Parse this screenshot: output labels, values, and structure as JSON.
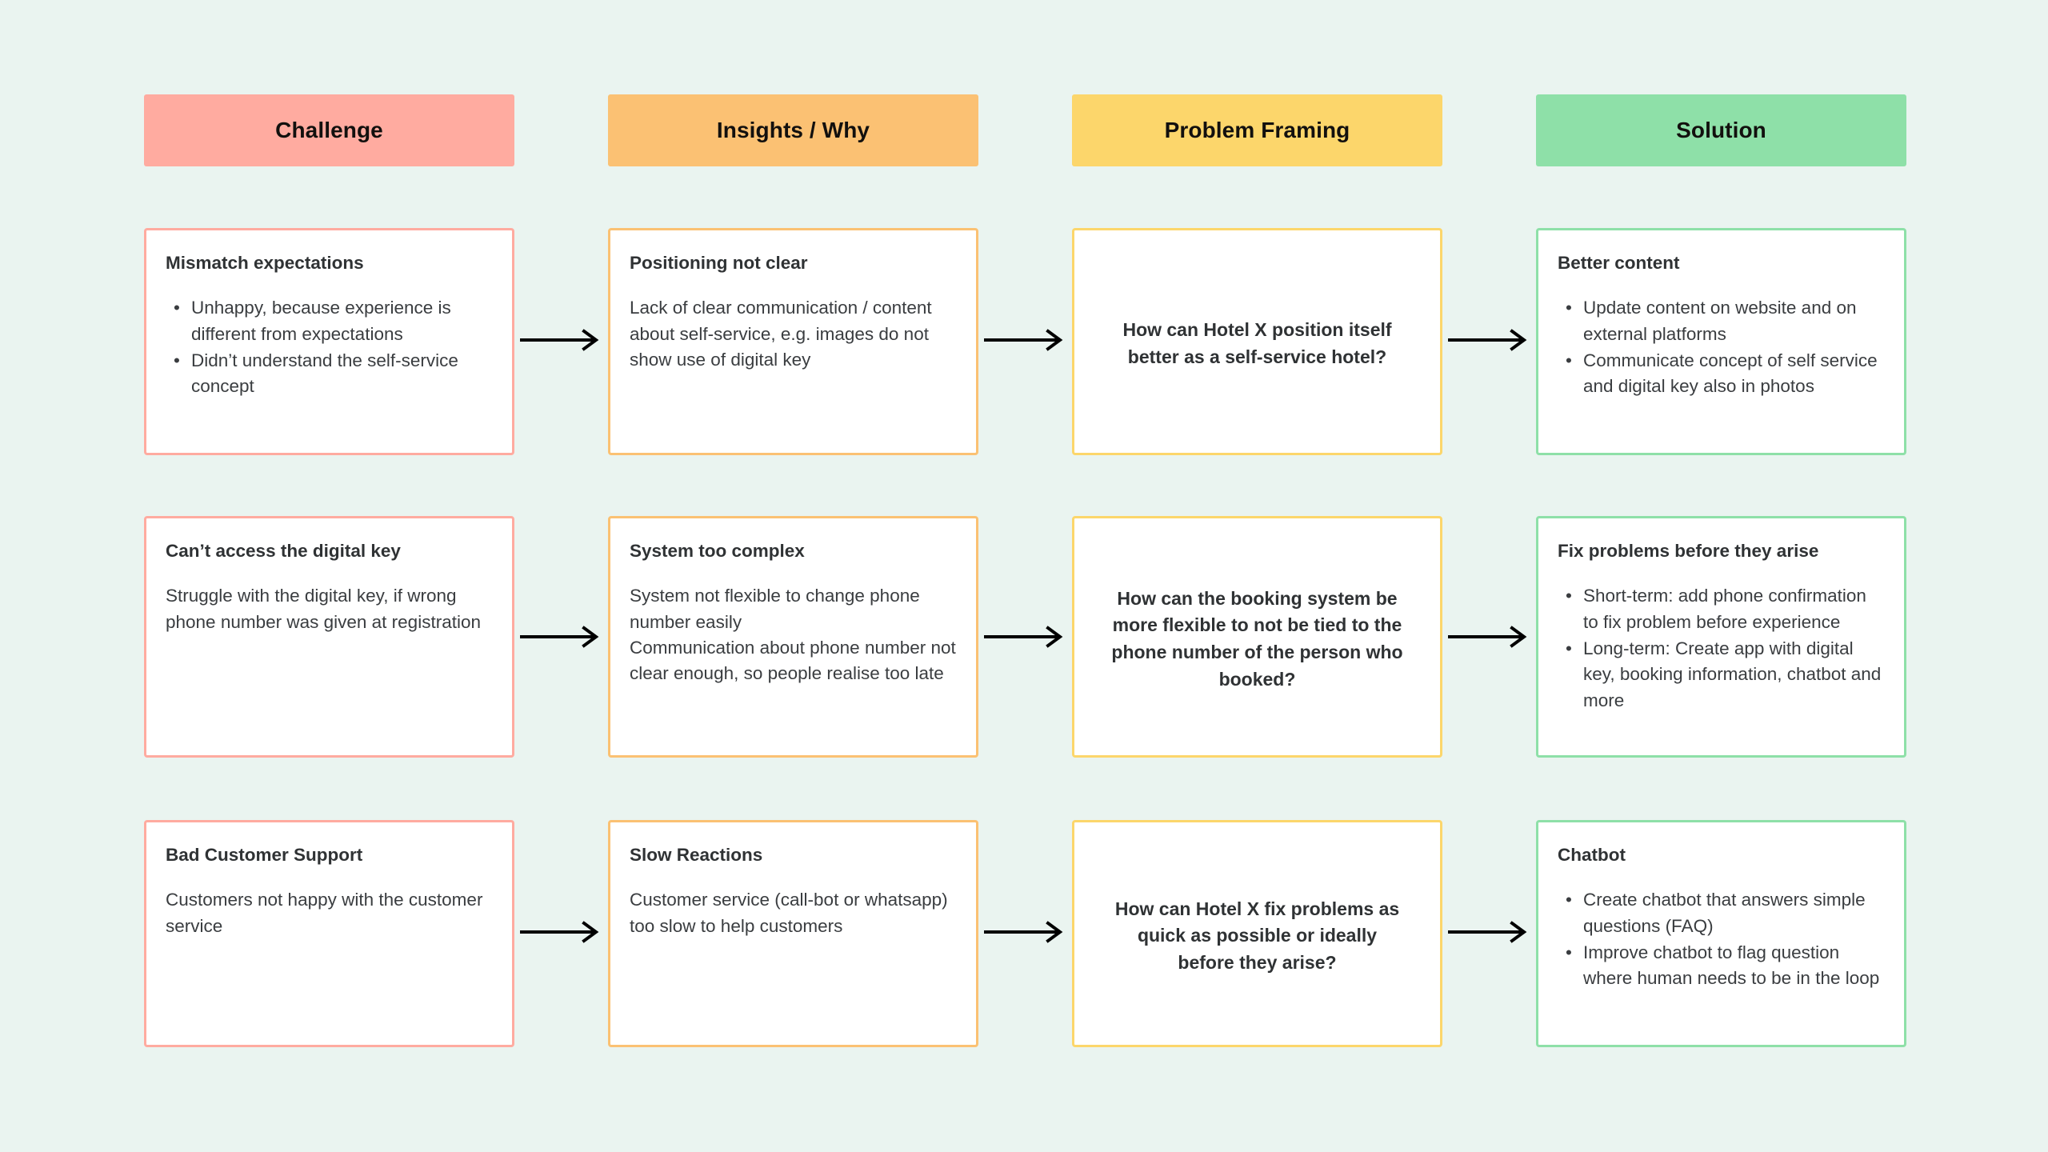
{
  "colors": {
    "background": "#eaf4f0",
    "challenge": "#ffaba0",
    "insights": "#fbc173",
    "problem": "#fcd66b",
    "solution": "#8ee0a8",
    "card_surface": "#ffffff",
    "arrow": "#000000",
    "heading_text": "#12100e",
    "body_text": "#3a3d40"
  },
  "columns": [
    {
      "key": "challenge",
      "label": "Challenge",
      "header_color": "#ffaba0",
      "border_color": "#ffaba0"
    },
    {
      "key": "insights",
      "label": "Insights / Why",
      "header_color": "#fbc173",
      "border_color": "#fbc173"
    },
    {
      "key": "problem",
      "label": "Problem Framing",
      "header_color": "#fcd66b",
      "border_color": "#fcd66b"
    },
    {
      "key": "solution",
      "label": "Solution",
      "header_color": "#8ee0a8",
      "border_color": "#8ee0a8"
    }
  ],
  "rows": [
    {
      "challenge": {
        "title": "Mismatch expectations",
        "bullets": [
          "Unhappy, because experience is different from expectations",
          "Didn’t understand the self-service concept"
        ]
      },
      "insights": {
        "title": "Positioning not clear",
        "paragraphs": [
          "Lack of clear communication / content about self-service, e.g. images do not show use of digital key"
        ]
      },
      "problem": {
        "question": "How can Hotel X position itself better as a self-service hotel?"
      },
      "solution": {
        "title": "Better content",
        "bullets": [
          "Update content on website and on external platforms",
          "Communicate concept of self service and digital key also in photos"
        ]
      }
    },
    {
      "challenge": {
        "title": "Can’t access the digital key",
        "paragraphs": [
          "Struggle with the digital key, if wrong phone number was given at registration"
        ]
      },
      "insights": {
        "title": "System too complex",
        "paragraphs": [
          "System not flexible to change phone number easily",
          "Communication about phone number not clear enough, so people realise too late"
        ]
      },
      "problem": {
        "question": "How can the booking system be more flexible to not be tied to the phone number of the person who booked?"
      },
      "solution": {
        "title": "Fix problems before they arise",
        "bullets": [
          "Short-term: add phone confirmation to fix problem before experience",
          "Long-term: Create app with digital key, booking information, chatbot and more"
        ]
      }
    },
    {
      "challenge": {
        "title": "Bad Customer Support",
        "paragraphs": [
          "Customers not happy with the customer service"
        ]
      },
      "insights": {
        "title": "Slow Reactions",
        "paragraphs": [
          "Customer service (call-bot or whatsapp) too slow to help customers"
        ]
      },
      "problem": {
        "question": "How can Hotel X fix problems as quick as possible or ideally before they arise?"
      },
      "solution": {
        "title": "Chatbot",
        "bullets": [
          "Create chatbot that answers simple questions (FAQ)",
          "Improve chatbot to flag question where human needs to be in the loop"
        ]
      }
    }
  ],
  "bullet_glyph": "•"
}
